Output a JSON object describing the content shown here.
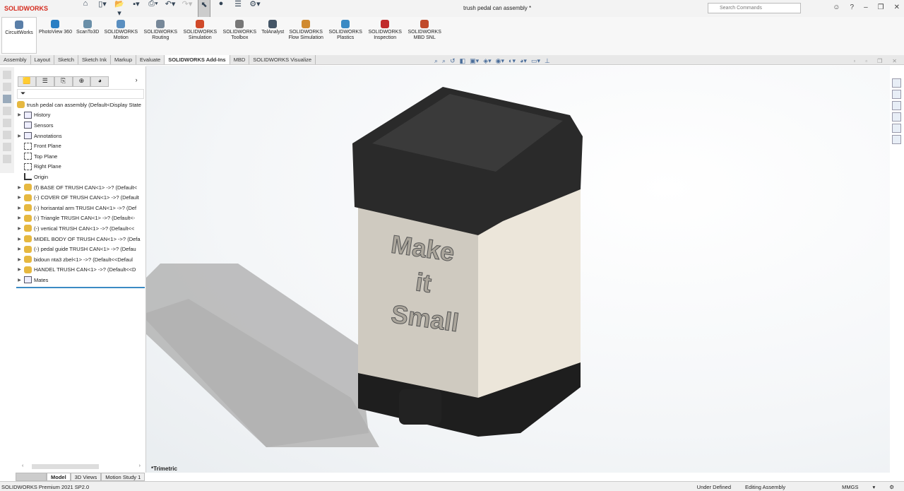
{
  "app": {
    "logo": "SOLIDWORKS",
    "title": "trush pedal can assembly *",
    "search_placeholder": "Search Commands"
  },
  "ribbon": [
    "CircuitWorks",
    "PhotoView 360",
    "ScanTo3D",
    "SOLIDWORKS Motion",
    "SOLIDWORKS Routing",
    "SOLIDWORKS Simulation",
    "SOLIDWORKS Toolbox",
    "TolAnalyst",
    "SOLIDWORKS Flow Simulation",
    "SOLIDWORKS Plastics",
    "SOLIDWORKS Inspection",
    "SOLIDWORKS MBD SNL"
  ],
  "ribbon_colors": [
    "#5a7fa8",
    "#2a7fc4",
    "#6a8fa8",
    "#5a8fc0",
    "#778899",
    "#d04a2a",
    "#777777",
    "#445566",
    "#d08a30",
    "#3a8ac4",
    "#c02a2a",
    "#c04a2a"
  ],
  "tabs": [
    "Assembly",
    "Layout",
    "Sketch",
    "Sketch Ink",
    "Markup",
    "Evaluate",
    "SOLIDWORKS Add-Ins",
    "MBD",
    "SOLIDWORKS Visualize"
  ],
  "active_tab": "SOLIDWORKS Add-Ins",
  "tree": [
    {
      "label": "trush pedal can assembly  (Default<Display State",
      "icon": "part",
      "arrow": false
    },
    {
      "label": "History",
      "icon": "fold",
      "arrow": true
    },
    {
      "label": "Sensors",
      "icon": "fold",
      "arrow": false
    },
    {
      "label": "Annotations",
      "icon": "fold",
      "arrow": true
    },
    {
      "label": "Front Plane",
      "icon": "plane",
      "arrow": false
    },
    {
      "label": "Top Plane",
      "icon": "plane",
      "arrow": false
    },
    {
      "label": "Right Plane",
      "icon": "plane",
      "arrow": false
    },
    {
      "label": "Origin",
      "icon": "origin",
      "arrow": false
    },
    {
      "label": "(f) BASE OF TRUSH CAN<1> ->? (Default<",
      "icon": "part",
      "arrow": true
    },
    {
      "label": "(-) COVER OF TRUSH CAN<1> ->? (Default",
      "icon": "part",
      "arrow": true
    },
    {
      "label": "(-) horisantal arm TRUSH CAN<1> ->? (Def",
      "icon": "part",
      "arrow": true
    },
    {
      "label": "(-) Triangle TRUSH CAN<1> ->? (Default<-",
      "icon": "part",
      "arrow": true
    },
    {
      "label": "(-) vertical  TRUSH CAN<1> ->? (Default<<",
      "icon": "part",
      "arrow": true
    },
    {
      "label": "MIDEL BODY OF TRUSH CAN<1> ->? (Defa",
      "icon": "part",
      "arrow": true
    },
    {
      "label": "(-) pedal guide TRUSH CAN<1> ->? (Defau",
      "icon": "part",
      "arrow": true
    },
    {
      "label": "bidoun nta3 zbel<1> ->? (Default<<Defaul",
      "icon": "part",
      "arrow": true
    },
    {
      "label": "HANDEL TRUSH CAN<1> ->? (Default<<D",
      "icon": "part",
      "arrow": true
    },
    {
      "label": "Mates",
      "icon": "fold",
      "arrow": true
    }
  ],
  "model": {
    "text_line1": "Make",
    "text_line2": "it",
    "text_line3": "Small"
  },
  "view_name": "*Trimetric",
  "bottom_tabs": [
    "Model",
    "3D Views",
    "Motion Study 1"
  ],
  "status": {
    "left": "SOLIDWORKS Premium 2021 SP2.0",
    "state": "Under Defined",
    "mode": "Editing Assembly",
    "units": "MMGS"
  }
}
